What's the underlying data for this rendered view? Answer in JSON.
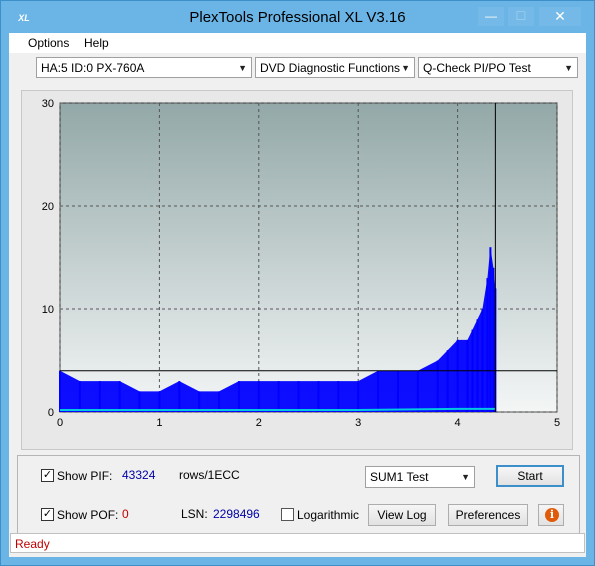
{
  "window": {
    "title": "PlexTools Professional XL V3.16",
    "icon_label": "XL",
    "minimize": "—",
    "maximize": "☐",
    "close": "✕"
  },
  "menu": {
    "options": "Options",
    "help": "Help"
  },
  "toolbar": {
    "drive": "HA:5 ID:0  PX-760A",
    "function": "DVD Diagnostic Functions",
    "test": "Q-Check PI/PO Test"
  },
  "chart_data": {
    "type": "bar",
    "x_ticks": [
      "0",
      "1",
      "2",
      "3",
      "4",
      "5"
    ],
    "y_ticks": [
      "0",
      "10",
      "20",
      "30"
    ],
    "xlim": [
      0,
      5
    ],
    "ylim": [
      0,
      30
    ],
    "grid": true,
    "threshold_line": 4,
    "end_marker_x": 4.38,
    "series": [
      {
        "color": "#0000ff",
        "values_note_free": true,
        "x": [
          0.0,
          0.2,
          0.4,
          0.6,
          0.8,
          1.0,
          1.2,
          1.4,
          1.6,
          1.8,
          2.0,
          2.2,
          2.4,
          2.6,
          2.8,
          3.0,
          3.2,
          3.4,
          3.6,
          3.8,
          3.9,
          4.0,
          4.1,
          4.15,
          4.2,
          4.25,
          4.3,
          4.33,
          4.36,
          4.38
        ],
        "y": [
          4,
          3,
          3,
          3,
          2,
          2,
          3,
          2,
          2,
          3,
          3,
          3,
          3,
          3,
          3,
          3,
          4,
          4,
          4,
          5,
          6,
          7,
          7,
          8,
          9,
          10,
          13,
          16,
          14,
          12
        ]
      },
      {
        "color": "#00c8e0",
        "x": [
          0.0,
          1.0,
          2.0,
          3.0,
          4.0,
          4.38
        ],
        "y": [
          0.2,
          0.2,
          0.2,
          0.2,
          0.3,
          0.3
        ]
      }
    ]
  },
  "controls": {
    "show_pif_label": "Show PIF:",
    "pif_value": "43324",
    "pif_unit": "rows/1ECC",
    "show_pof_label": "Show POF:",
    "pof_value": "0",
    "lsn_label": "LSN:",
    "lsn_value": "2298496",
    "logarithmic_label": "Logarithmic",
    "sum_select": "SUM1 Test",
    "start": "Start",
    "view_log": "View Log",
    "preferences": "Preferences",
    "help_glyph": "i",
    "check_mark": "✓"
  },
  "status": {
    "text": "Ready"
  }
}
